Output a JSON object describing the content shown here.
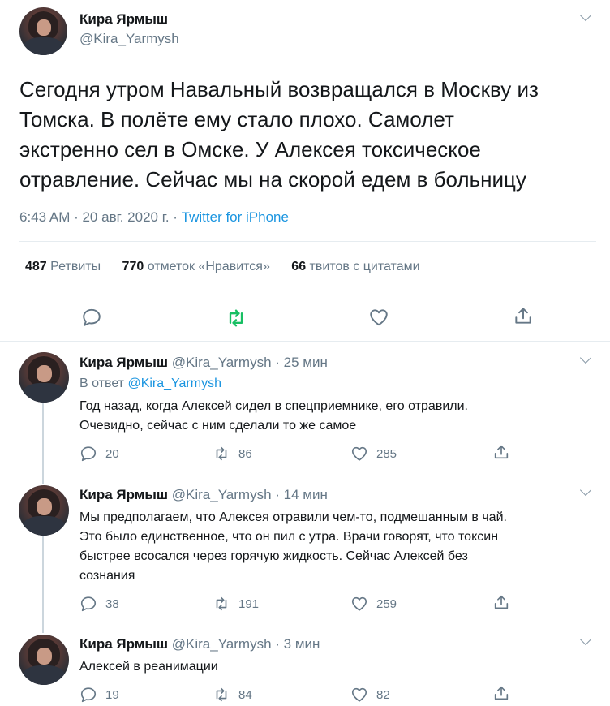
{
  "main_tweet": {
    "author_name": "Кира Ярмыш",
    "author_handle": "@Kira_Yarmysh",
    "text_lines": [
      "Сегодня утром Навальный возвращался в Москву из",
      "Томска. В полёте ему стало плохо. Самолет",
      "экстренно сел в Омске. У Алексея токсическое",
      "отравление. Сейчас мы на скорой едем в больницу"
    ],
    "time": "6:43 AM · 20 авг. 2020 г. · ",
    "source": "Twitter for iPhone",
    "stats": [
      {
        "count": "487",
        "label": "Ретвиты"
      },
      {
        "count": "770",
        "label": "отметок «Нравится»"
      },
      {
        "count": "66",
        "label": "твитов с цитатами"
      }
    ]
  },
  "replies": [
    {
      "author_name": "Кира Ярмыш",
      "author_handle": "@Kira_Yarmysh",
      "time": "· 25 мин",
      "reply_to_prefix": "В ответ ",
      "reply_to_handle": "@Kira_Yarmysh",
      "text_lines": [
        "Год назад, когда Алексей сидел в спецприемнике, его отравили.",
        "Очевидно, сейчас с ним сделали то же самое"
      ],
      "replies_count": "20",
      "retweets_count": "86",
      "likes_count": "285"
    },
    {
      "author_name": "Кира Ярмыш",
      "author_handle": "@Kira_Yarmysh",
      "time": "· 14 мин",
      "text_lines": [
        "Мы предполагаем, что Алексея отравили чем-то, подмешанным в чай.",
        "Это было единственное, что он пил с утра. Врачи говорят, что токсин",
        "быстрее всосался через горячую жидкость. Сейчас Алексей без",
        "сознания"
      ],
      "replies_count": "38",
      "retweets_count": "191",
      "likes_count": "259"
    },
    {
      "author_name": "Кира Ярмыш",
      "author_handle": "@Kira_Yarmysh",
      "time": "· 3 мин",
      "text_lines": [
        "Алексей в реанимации"
      ],
      "replies_count": "19",
      "retweets_count": "84",
      "likes_count": "82"
    }
  ],
  "colors": {
    "accent": "#1b95e0",
    "retweet_green": "#17bf63",
    "muted": "#657786",
    "divider": "#e6ecf0"
  },
  "icons": [
    "reply-icon",
    "retweet-icon",
    "like-icon",
    "share-icon",
    "chevron-down-icon"
  ]
}
